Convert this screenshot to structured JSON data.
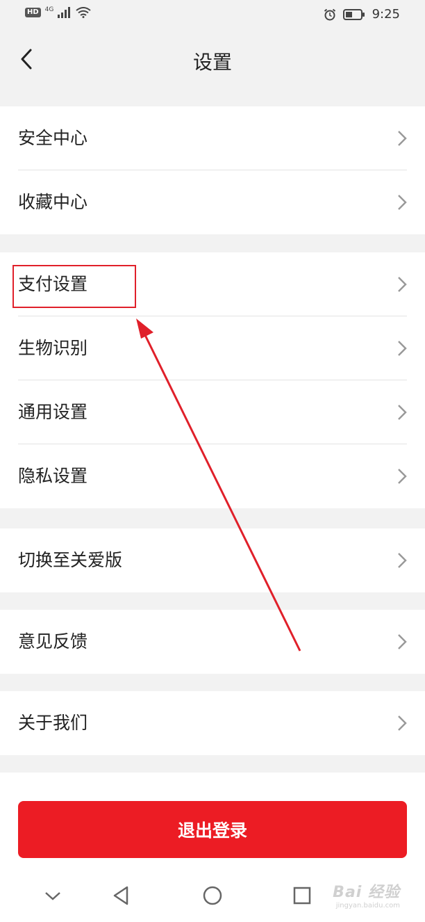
{
  "status_bar": {
    "hd_badge": "HD",
    "network": "4G",
    "time": "9:25",
    "icons": [
      "signal-icon",
      "wifi-icon",
      "alarm-icon",
      "battery-icon"
    ]
  },
  "header": {
    "title": "设置",
    "back_icon": "back-arrow-icon"
  },
  "groups": [
    {
      "items": [
        {
          "label": "安全中心"
        },
        {
          "label": "收藏中心"
        }
      ]
    },
    {
      "items": [
        {
          "label": "支付设置"
        },
        {
          "label": "生物识别"
        },
        {
          "label": "通用设置"
        },
        {
          "label": "隐私设置"
        }
      ]
    },
    {
      "items": [
        {
          "label": "切换至关爱版"
        }
      ]
    },
    {
      "items": [
        {
          "label": "意见反馈"
        }
      ]
    },
    {
      "items": [
        {
          "label": "关于我们"
        }
      ]
    }
  ],
  "logout": {
    "label": "退出登录"
  },
  "annotation": {
    "highlight_color": "#e0202a",
    "arrow_color": "#e0202a"
  },
  "colors": {
    "accent": "#ec1c24",
    "background": "#f2f2f2",
    "row_background": "#ffffff"
  },
  "system_nav": [
    "collapse-icon",
    "back-triangle-icon",
    "home-circle-icon",
    "recents-square-icon"
  ],
  "watermark": {
    "main": "Bai 经验",
    "sub": "jingyan.baidu.com"
  }
}
